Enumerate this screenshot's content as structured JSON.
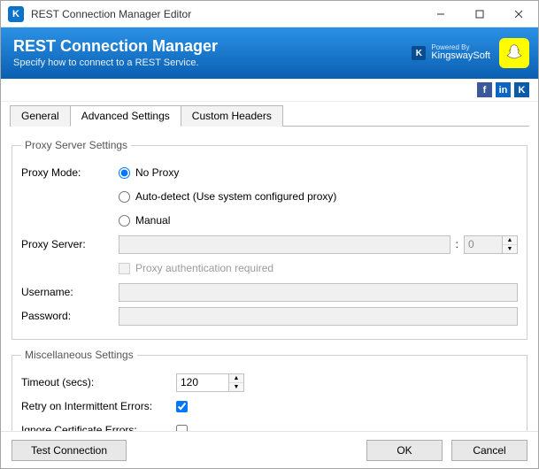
{
  "window_title": "REST Connection Manager Editor",
  "banner": {
    "title": "REST Connection Manager",
    "subtitle": "Specify how to connect to a REST Service."
  },
  "logo": {
    "powered_by": "Powered By",
    "name": "KingswaySoft"
  },
  "social": {
    "mail": "mail-icon",
    "twitter": "twitter-icon",
    "facebook": "facebook-icon",
    "linkedin": "linkedin-icon",
    "ks": "kingswaysoft-icon"
  },
  "tabs": {
    "general": "General",
    "advanced": "Advanced Settings",
    "custom": "Custom Headers",
    "active": "advanced"
  },
  "proxy": {
    "legend": "Proxy Server Settings",
    "mode_label": "Proxy Mode:",
    "options": {
      "none": "No Proxy",
      "auto": "Auto-detect (Use system configured proxy)",
      "manual": "Manual"
    },
    "selected": "none",
    "server_label": "Proxy Server:",
    "server_value": "",
    "port_value": "0",
    "colon": ":",
    "auth_label": "Proxy authentication required",
    "username_label": "Username:",
    "username_value": "",
    "password_label": "Password:",
    "password_value": ""
  },
  "misc": {
    "legend": "Miscellaneous Settings",
    "timeout_label": "Timeout (secs):",
    "timeout_value": "120",
    "retry_label": "Retry on Intermittent Errors:",
    "retry_checked": true,
    "ignore_label": "Ignore Certificate Errors:",
    "ignore_checked": false
  },
  "footer": {
    "test": "Test Connection",
    "ok": "OK",
    "cancel": "Cancel"
  }
}
